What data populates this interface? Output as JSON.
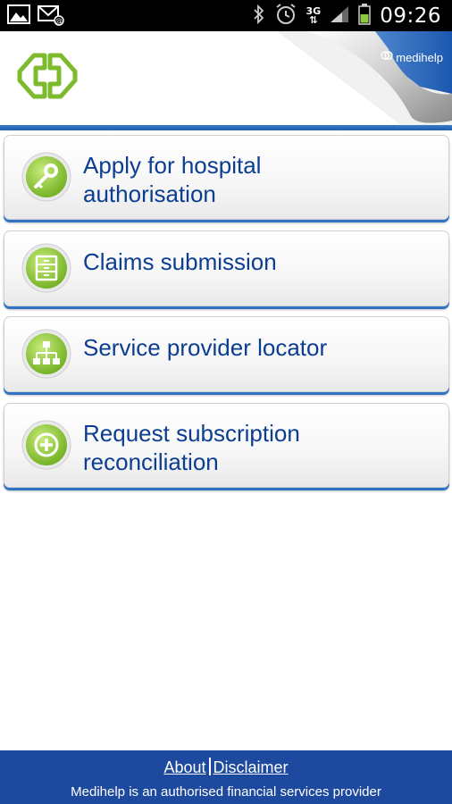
{
  "status_bar": {
    "time": "09:26",
    "network": "3G",
    "icons": [
      "gallery-icon",
      "email-icon",
      "bluetooth-icon",
      "alarm-icon",
      "network-3g-icon",
      "signal-icon",
      "battery-icon"
    ]
  },
  "header": {
    "brand": "medihelp",
    "logo_icon": "medihelp-logo-icon"
  },
  "menu": {
    "items": [
      {
        "label_line1": "Apply for hospital",
        "label_line2": "authorisation",
        "icon": "key-icon"
      },
      {
        "label_line1": "Claims submission",
        "label_line2": "",
        "icon": "cabinet-icon"
      },
      {
        "label_line1": "Service provider locator",
        "label_line2": "",
        "icon": "network-hierarchy-icon"
      },
      {
        "label_line1": "Request subscription",
        "label_line2": "reconciliation",
        "icon": "plus-circle-icon"
      }
    ]
  },
  "footer": {
    "about": "About",
    "disclaimer": "Disclaimer",
    "note": "Medihelp is an authorised financial services provider"
  },
  "colors": {
    "accent_blue": "#1d4a9e",
    "label_blue": "#0b3d91",
    "icon_green": "#8cc63f"
  }
}
